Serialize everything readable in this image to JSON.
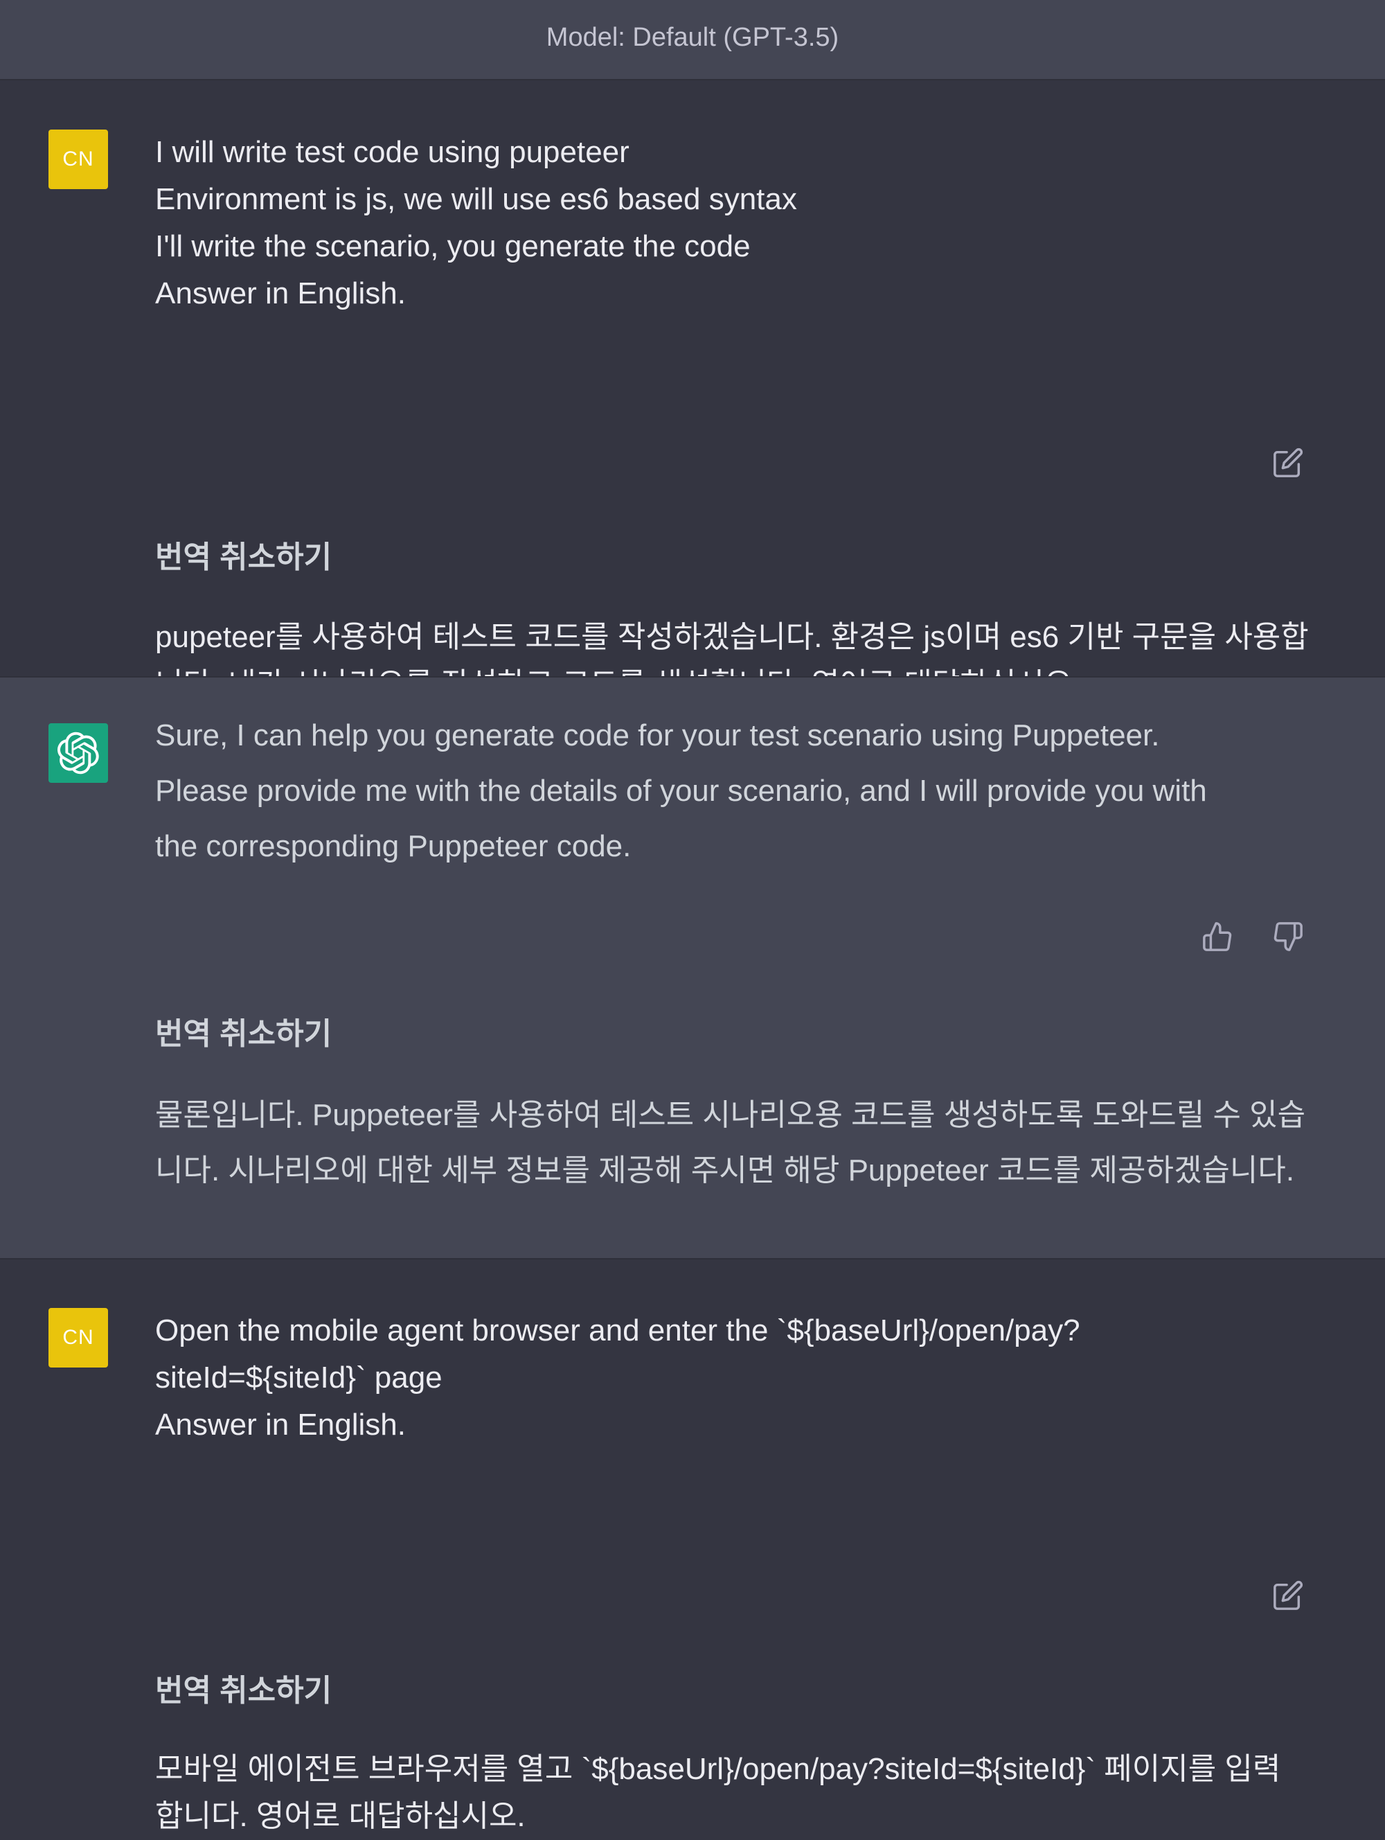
{
  "header": {
    "model_label": "Model: Default (GPT-3.5)"
  },
  "colors": {
    "background": "#343541",
    "assistant_background": "#444654",
    "user_avatar": "#e9c40c",
    "assistant_avatar": "#19a37e"
  },
  "messages": [
    {
      "role": "user",
      "avatar_initials": "CN",
      "lines": [
        "I will write test code using pupeteer",
        "Environment is js, we will use es6 based syntax",
        "I'll write the scenario, you generate the code",
        "Answer in English."
      ],
      "action_icon": "edit-icon",
      "cancel_translation_label": "번역 취소하기",
      "translation_lines": [
        "pupeteer를 사용하여 테스트 코드를 작성하겠습니다. 환경은 js이며 es6 기반 구문을 사용합",
        "니다. 내가 시나리오를 작성하고 코드를 생성합니다. 영어로 대답하십시오."
      ]
    },
    {
      "role": "assistant",
      "avatar_icon": "openai-logo-icon",
      "lines": [
        "Sure, I can help you generate code for your test scenario using Puppeteer.",
        "Please provide me with the details of your scenario, and I will provide you with",
        "the corresponding Puppeteer code."
      ],
      "action_icons": [
        "thumbs-up-icon",
        "thumbs-down-icon"
      ],
      "cancel_translation_label": "번역 취소하기",
      "translation_lines": [
        "물론입니다. Puppeteer를 사용하여 테스트 시나리오용 코드를 생성하도록 도와드릴 수 있습",
        "니다. 시나리오에 대한 세부 정보를 제공해 주시면 해당 Puppeteer 코드를 제공하겠습니다."
      ]
    },
    {
      "role": "user",
      "avatar_initials": "CN",
      "lines": [
        "Open the mobile agent browser and enter the `${baseUrl}/open/pay?",
        "siteId=${siteId}` page",
        "Answer in English."
      ],
      "action_icon": "edit-icon",
      "cancel_translation_label": "번역 취소하기",
      "translation_lines": [
        "모바일 에이전트 브라우저를 열고 `${baseUrl}/open/pay?siteId=${siteId}` 페이지를 입력",
        "합니다. 영어로 대답하십시오."
      ]
    }
  ]
}
